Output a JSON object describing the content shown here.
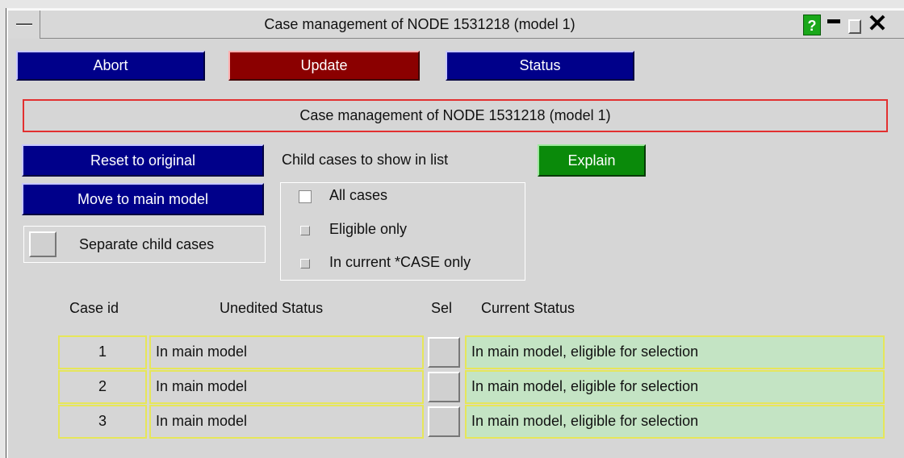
{
  "window": {
    "title": "Case management of NODE 1531218 (model 1)",
    "help_label": "?"
  },
  "toolbar": {
    "abort_label": "Abort",
    "update_label": "Update",
    "status_label": "Status"
  },
  "panel": {
    "title": "Case management of NODE 1531218 (model 1)"
  },
  "actions": {
    "reset_label": "Reset to original",
    "move_label": "Move to main model",
    "separate_label": "Separate child cases",
    "explain_label": "Explain"
  },
  "filter": {
    "heading": "Child cases to show in list",
    "options": [
      {
        "label": "All cases",
        "checked": true
      },
      {
        "label": "Eligible only",
        "checked": false
      },
      {
        "label": "In current *CASE only",
        "checked": false
      }
    ]
  },
  "table": {
    "headers": {
      "case_id": "Case id",
      "unedited": "Unedited Status",
      "sel": "Sel",
      "current": "Current Status"
    },
    "rows": [
      {
        "id": "1",
        "unedited": "In main model",
        "current": "In main model, eligible for selection"
      },
      {
        "id": "2",
        "unedited": "In main model",
        "current": "In main model, eligible for selection"
      },
      {
        "id": "3",
        "unedited": "In main model",
        "current": "In main model, eligible for selection"
      }
    ]
  },
  "colors": {
    "button_blue": "#00008a",
    "button_red": "#8b0000",
    "button_green": "#0a8a0a",
    "title_border": "#e23030",
    "cell_border": "#e6e65a",
    "current_cell_bg": "#c4e4c4"
  }
}
